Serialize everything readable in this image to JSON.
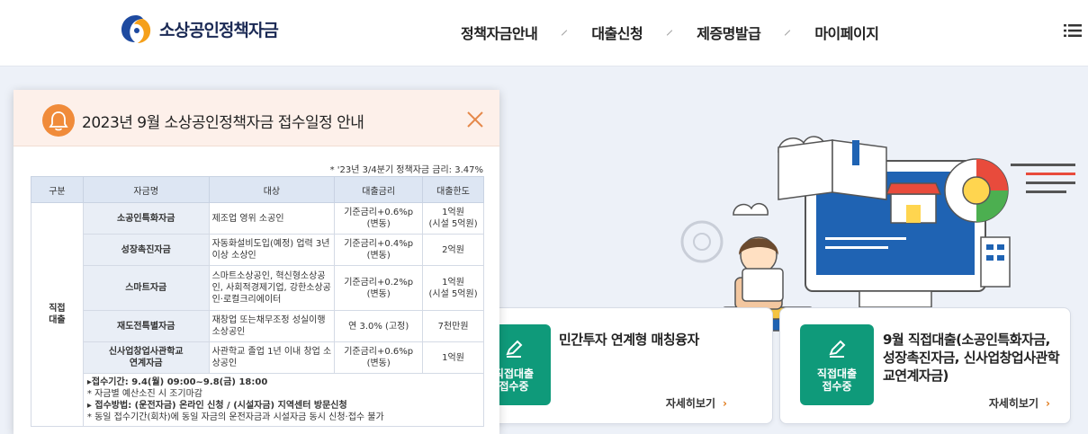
{
  "header": {
    "logo_text": "소상공인정책자금",
    "nav": [
      "정책자금안내",
      "대출신청",
      "제증명발급",
      "마이페이지"
    ]
  },
  "popup": {
    "title": "2023년 9월 소상공인정책자금 접수일정 안내",
    "rate_note": "* '23년 3/4분기 정책자금 금리: 3.47%",
    "headers": [
      "구분",
      "자금명",
      "대상",
      "대출금리",
      "대출한도"
    ],
    "group_label": "직접\n대출",
    "rows": [
      {
        "name": "소공인특화자금",
        "target": "제조업 영위 소공인",
        "rate": "기준금리+0.6%p\n(변동)",
        "limit": "1억원\n(시설 5억원)"
      },
      {
        "name": "성장촉진자금",
        "target": "자동화설비도입(예정) 업력 3년 이상 소상인",
        "rate": "기준금리+0.4%p\n(변동)",
        "limit": "2억원"
      },
      {
        "name": "스마트자금",
        "target": "스마트소상공인, 혁신형소상공인, 사회적경제기업, 강한소상공인·로컬크리에이터",
        "rate": "기준금리+0.2%p\n(변동)",
        "limit": "1억원\n(시설 5억원)"
      },
      {
        "name": "재도전특별자금",
        "target": "재창업 또는채무조정 성실이행 소상공인",
        "rate": "연 3.0% (고정)",
        "limit": "7천만원"
      },
      {
        "name": "신사업창업사관학교\n연계자금",
        "target": "사관학교 졸업 1년 이내 창업 소상공인",
        "rate": "기준금리+0.6%p\n(변동)",
        "limit": "1억원"
      }
    ],
    "notes": [
      {
        "text": "▸접수기간: 9.4(월) 09:00~9.8(금) 18:00",
        "bold": true
      },
      {
        "text": "* 자금별 예산소진 시 조기마감",
        "bold": false
      },
      {
        "text": "▸ 접수방법: (운전자금) 온라인 신청 / (시설자금) 지역센터 방문신청",
        "bold": true
      },
      {
        "text": "* 동일 접수기간(회차)에 동일 자금의 운전자금과 시설자금 동시 신청·접수 불가",
        "bold": false
      }
    ]
  },
  "cards": [
    {
      "badge": "직접대출\n접수중",
      "title": "민간투자 연계형 매칭융자",
      "more": "자세히보기"
    },
    {
      "badge": "직접대출\n접수중",
      "title": "9월 직접대출(소공인특화자금, 성장촉진자금, 신사업창업사관학교연계자금)",
      "more": "자세히보기"
    }
  ],
  "colors": {
    "accent_green": "#0f9a7a",
    "accent_orange": "#f08b3a",
    "table_header": "#dde6f3"
  }
}
